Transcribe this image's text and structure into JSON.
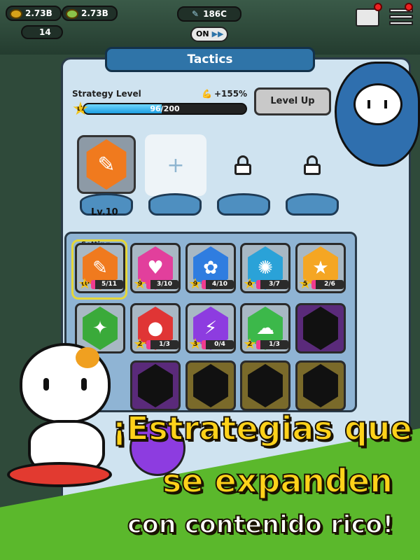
{
  "hud": {
    "res1": "2.73B",
    "res2": "2.73B",
    "res3": "14",
    "gems": "186C",
    "toggle": "ON"
  },
  "panel": {
    "title": "Tactics",
    "strategy_label": "Strategy Level",
    "bonus": "+155%",
    "level": "17",
    "progress_text": "96/200",
    "progress_fraction": 0.48,
    "levelup": "Level Up"
  },
  "equipped": {
    "level_text": "Lv.10",
    "add_symbol": "+"
  },
  "grid": {
    "setting_label": "Setting",
    "cells": [
      {
        "level": "10",
        "count": "5/11",
        "icon": "muscle-tactic-icon",
        "color": "#f07a1e"
      },
      {
        "level": "9",
        "count": "3/10",
        "icon": "heart-plus-icon",
        "color": "#e23f9c"
      },
      {
        "level": "9",
        "count": "4/10",
        "icon": "paw-icon",
        "color": "#2f7de0"
      },
      {
        "level": "6",
        "count": "3/7",
        "icon": "net-icon",
        "color": "#2aa2d8"
      },
      {
        "level": "5",
        "count": "2/6",
        "icon": "heart-star-icon",
        "color": "#f5a623"
      },
      {
        "level": "",
        "count": "",
        "icon": "shatter-icon",
        "color": "#3aaa3a"
      },
      {
        "level": "2",
        "count": "1/3",
        "icon": "blood-drop-icon",
        "color": "#e03535"
      },
      {
        "level": "3",
        "count": "0/4",
        "icon": "lightning-icon",
        "color": "#8d3ce0"
      },
      {
        "level": "2",
        "count": "1/3",
        "icon": "poison-cloud-icon",
        "color": "#3cb84a"
      }
    ]
  },
  "promo": {
    "line1": "¡Estrategias que",
    "line2": "se expanden",
    "line3": "con contenido rico!"
  }
}
